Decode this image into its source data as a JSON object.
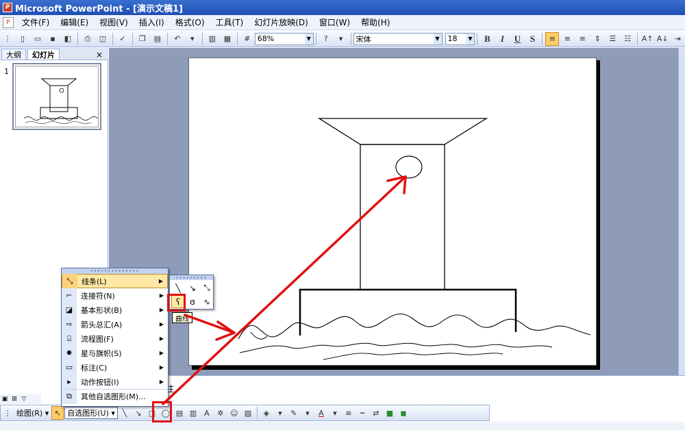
{
  "window": {
    "title": "Microsoft PowerPoint - [演示文稿1]",
    "app_icon": "ppt-icon"
  },
  "menubar": {
    "items": [
      {
        "label": "文件(F)"
      },
      {
        "label": "编辑(E)"
      },
      {
        "label": "视图(V)"
      },
      {
        "label": "插入(I)"
      },
      {
        "label": "格式(O)"
      },
      {
        "label": "工具(T)"
      },
      {
        "label": "幻灯片放映(D)"
      },
      {
        "label": "窗口(W)"
      },
      {
        "label": "帮助(H)"
      }
    ]
  },
  "toolbar": {
    "zoom": "68%",
    "font_name": "宋体",
    "font_size": "18",
    "bold": "B",
    "italic": "I",
    "underline": "U",
    "shadow": "S"
  },
  "left_pane": {
    "tabs": [
      "大纲",
      "幻灯片"
    ],
    "active_tab": "幻灯片",
    "close": "×",
    "slide_number": "1"
  },
  "notes": {
    "label_fragment": "注"
  },
  "drawing_toolbar": {
    "draw_label": "绘图(R) ▾",
    "autoshapes_label": "自选图形(U) ▾"
  },
  "autoshape_menu": {
    "items": [
      {
        "label": "线条(L)",
        "icon": "lines-icon",
        "has_sub": true
      },
      {
        "label": "连接符(N)",
        "icon": "connector-icon",
        "has_sub": true
      },
      {
        "label": "基本形状(B)",
        "icon": "basic-shapes-icon",
        "has_sub": true
      },
      {
        "label": "箭头总汇(A)",
        "icon": "block-arrows-icon",
        "has_sub": true
      },
      {
        "label": "流程图(F)",
        "icon": "flowchart-icon",
        "has_sub": true
      },
      {
        "label": "星与旗帜(S)",
        "icon": "stars-banners-icon",
        "has_sub": true
      },
      {
        "label": "标注(C)",
        "icon": "callouts-icon",
        "has_sub": true
      },
      {
        "label": "动作按钮(I)",
        "icon": "action-buttons-icon",
        "has_sub": true
      },
      {
        "label": "其他自选图形(M)...",
        "icon": "more-shapes-icon",
        "has_sub": false
      }
    ]
  },
  "lines_submenu": {
    "tooltip": "曲线",
    "selected": "curve-tool"
  },
  "colors": {
    "title_bar": "#2a5cc2",
    "annotation_red": "#e01010",
    "workspace": "#8e9bb9",
    "menu_highlight": "#ffe8a6"
  }
}
